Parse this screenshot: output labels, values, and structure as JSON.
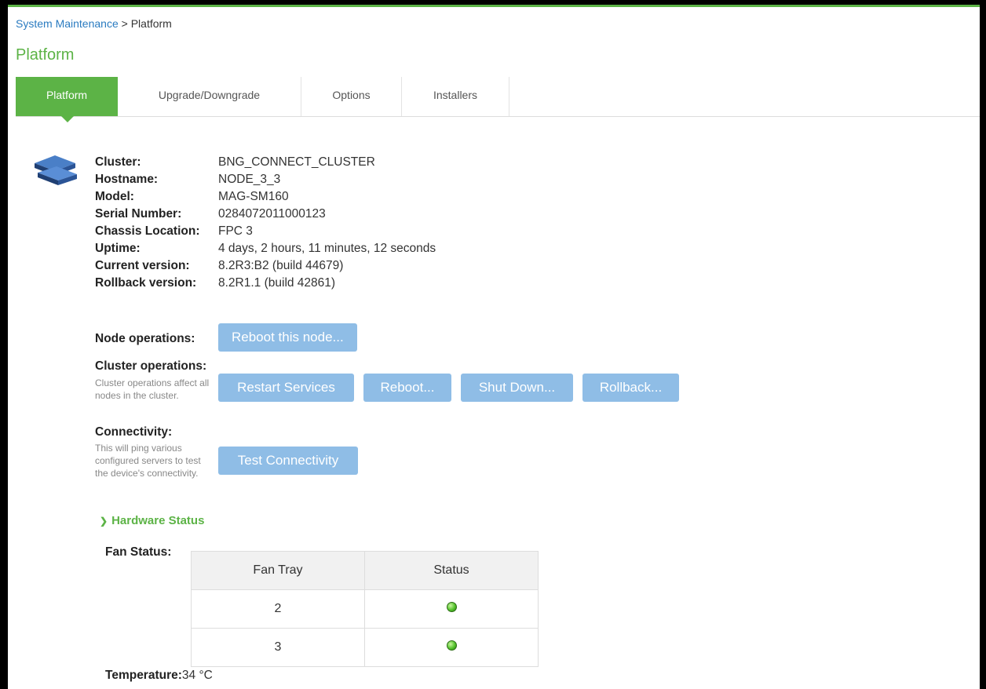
{
  "breadcrumb": {
    "parent": "System Maintenance",
    "separator": " > ",
    "current": "Platform"
  },
  "page_title": "Platform",
  "tabs": [
    {
      "label": "Platform",
      "active": true
    },
    {
      "label": "Upgrade/Downgrade",
      "active": false
    },
    {
      "label": "Options",
      "active": false
    },
    {
      "label": "Installers",
      "active": false
    }
  ],
  "device_icon": "server-stack-icon",
  "info": [
    {
      "label": "Cluster:",
      "value": "BNG_CONNECT_CLUSTER"
    },
    {
      "label": "Hostname:",
      "value": "NODE_3_3"
    },
    {
      "label": "Model:",
      "value": "MAG-SM160"
    },
    {
      "label": "Serial Number:",
      "value": "0284072011000123"
    },
    {
      "label": "Chassis Location:",
      "value": "FPC 3"
    },
    {
      "label": "Uptime:",
      "value": "4 days, 2 hours, 11 minutes, 12 seconds"
    },
    {
      "label": "Current version:",
      "value": "8.2R3:B2 (build 44679)"
    },
    {
      "label": "Rollback version:",
      "value": "8.2R1.1 (build 42861)"
    }
  ],
  "node_ops": {
    "label": "Node operations:",
    "reboot_button": "Reboot this node..."
  },
  "cluster_ops": {
    "label": "Cluster operations:",
    "help": "Cluster operations affect all nodes in the cluster.",
    "buttons": [
      "Restart Services",
      "Reboot...",
      "Shut Down...",
      "Rollback..."
    ]
  },
  "connectivity": {
    "label": "Connectivity:",
    "help": "This will ping various configured servers to test the device's connectivity.",
    "button": "Test Connectivity"
  },
  "hardware_status": {
    "toggle_label": "Hardware Status",
    "fan_label": "Fan Status:",
    "fan_table": {
      "headers": [
        "Fan Tray",
        "Status"
      ],
      "rows": [
        {
          "tray": "2",
          "status": "ok"
        },
        {
          "tray": "3",
          "status": "ok"
        }
      ]
    },
    "temperature_label": "Temperature:",
    "temperature_value": "34 °C"
  },
  "colors": {
    "accent": "#5cb346",
    "button": "#8fbde6",
    "link": "#2a7bc0"
  }
}
